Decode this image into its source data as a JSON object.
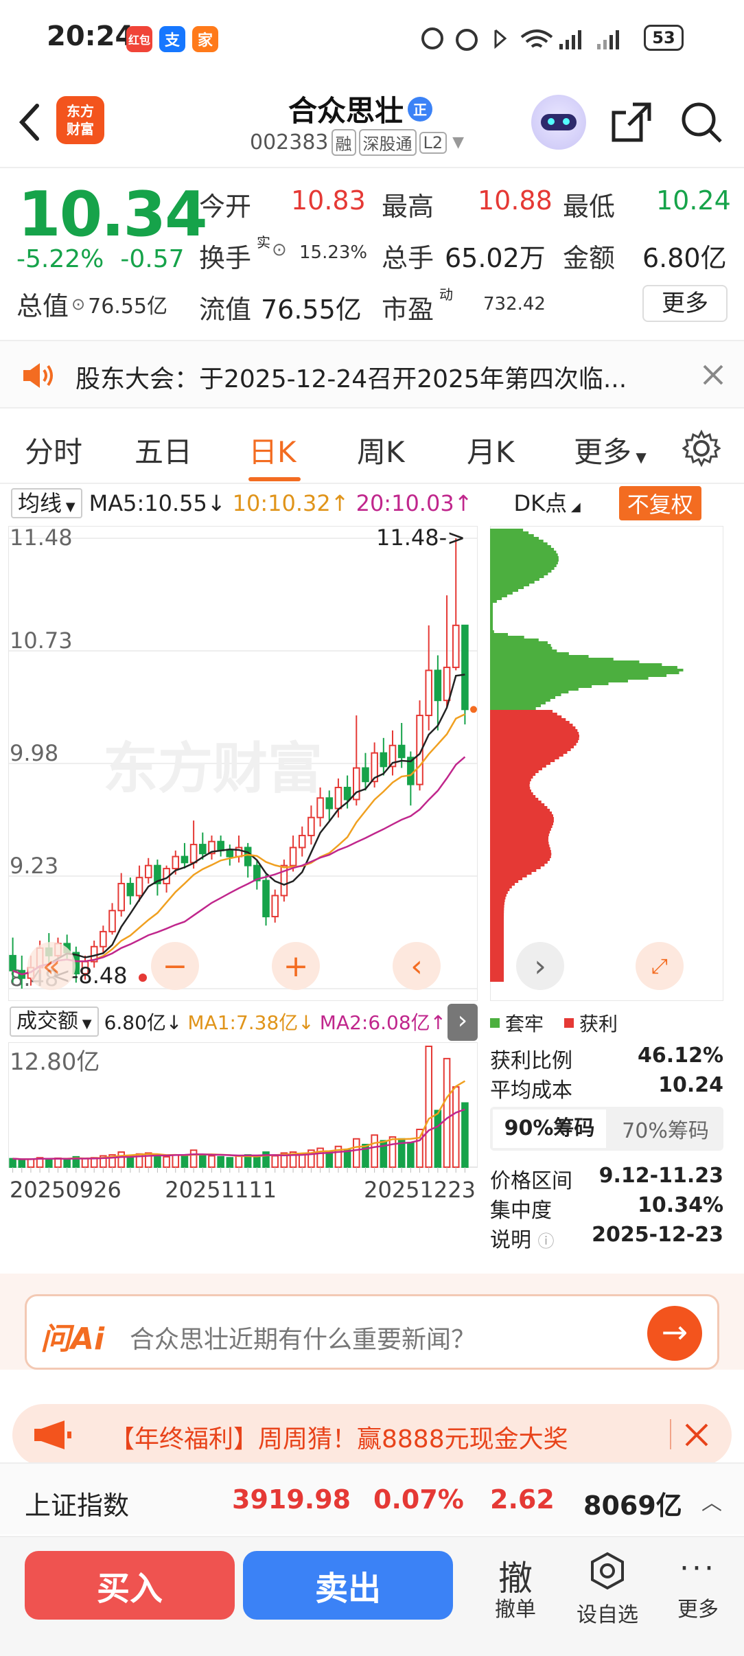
{
  "status": {
    "time": "20:24",
    "battery": "53",
    "app_icons": [
      "红包",
      "支",
      "家"
    ]
  },
  "header": {
    "logo": "东方\n财富",
    "name": "合众思壮",
    "code": "002383",
    "tags": [
      "融",
      "深股通",
      "L2"
    ],
    "zheng": "正"
  },
  "quote": {
    "price": "10.34",
    "pct": "-5.22%",
    "chg": "-0.57",
    "open_label": "今开",
    "open": "10.83",
    "high_label": "最高",
    "high": "10.88",
    "low_label": "最低",
    "low": "10.24",
    "turnover_label": "换手",
    "turnover_sup": "实",
    "turnover": "15.23%",
    "vol_label": "总手",
    "vol": "65.02万",
    "amount_label": "金额",
    "amount": "6.80亿",
    "mcap_label": "总值",
    "mcap": "76.55亿",
    "float_label": "流值",
    "float": "76.55亿",
    "pe_label": "市盈",
    "pe_sup": "动",
    "pe": "732.42",
    "more": "更多"
  },
  "notice": {
    "text": "股东大会：于2025-12-24召开2025年第四次临..."
  },
  "tabs": [
    "分时",
    "五日",
    "日K",
    "周K",
    "月K",
    "更多"
  ],
  "kbar": {
    "indicator": "均线",
    "ma5": "MA5:10.55↓",
    "ma10": "10:10.32↑",
    "ma20": "20:10.03↑",
    "dk": "DK点",
    "fq": "不复权"
  },
  "colors": {
    "up": "#e53935",
    "down": "#16a34a",
    "accent": "#f36c21",
    "ma5": "#222222",
    "ma10": "#f0a020",
    "ma20": "#c0268c"
  },
  "chart_data": {
    "type": "candlestick",
    "y_labels": [
      "11.48",
      "10.73",
      "9.98",
      "9.23",
      "8.48"
    ],
    "ylim": [
      8.48,
      11.48
    ],
    "max_label": "11.48->",
    "min_label": "<-8.48",
    "x_labels": [
      "20250926",
      "20251111",
      "20251223"
    ],
    "candles": [
      [
        8.7,
        8.6,
        8.82,
        8.52
      ],
      [
        8.6,
        8.55,
        8.7,
        8.48
      ],
      [
        8.55,
        8.62,
        8.7,
        8.5
      ],
      [
        8.62,
        8.75,
        8.8,
        8.58
      ],
      [
        8.75,
        8.7,
        8.85,
        8.64
      ],
      [
        8.7,
        8.78,
        8.82,
        8.66
      ],
      [
        8.78,
        8.72,
        8.84,
        8.68
      ],
      [
        8.72,
        8.58,
        8.76,
        8.52
      ],
      [
        8.58,
        8.66,
        8.7,
        8.54
      ],
      [
        8.66,
        8.76,
        8.8,
        8.62
      ],
      [
        8.76,
        8.86,
        8.9,
        8.72
      ],
      [
        8.86,
        9.0,
        9.05,
        8.84
      ],
      [
        9.0,
        9.18,
        9.25,
        8.96
      ],
      [
        9.18,
        9.1,
        9.22,
        9.04
      ],
      [
        9.1,
        9.22,
        9.3,
        9.06
      ],
      [
        9.22,
        9.3,
        9.35,
        9.18
      ],
      [
        9.3,
        9.18,
        9.34,
        9.1
      ],
      [
        9.18,
        9.28,
        9.3,
        9.12
      ],
      [
        9.28,
        9.36,
        9.4,
        9.24
      ],
      [
        9.36,
        9.32,
        9.45,
        9.28
      ],
      [
        9.32,
        9.44,
        9.6,
        9.28
      ],
      [
        9.44,
        9.38,
        9.52,
        9.34
      ],
      [
        9.38,
        9.46,
        9.5,
        9.34
      ],
      [
        9.46,
        9.4,
        9.5,
        9.36
      ],
      [
        9.4,
        9.36,
        9.44,
        9.3
      ],
      [
        9.36,
        9.42,
        9.5,
        9.32
      ],
      [
        9.42,
        9.3,
        9.45,
        9.22
      ],
      [
        9.3,
        9.2,
        9.34,
        9.14
      ],
      [
        9.2,
        8.96,
        9.24,
        8.9
      ],
      [
        8.96,
        9.1,
        9.14,
        8.92
      ],
      [
        9.1,
        9.3,
        9.34,
        9.06
      ],
      [
        9.3,
        9.42,
        9.5,
        9.26
      ],
      [
        9.42,
        9.5,
        9.56,
        9.36
      ],
      [
        9.5,
        9.62,
        9.7,
        9.44
      ],
      [
        9.62,
        9.75,
        9.82,
        9.56
      ],
      [
        9.75,
        9.68,
        9.8,
        9.6
      ],
      [
        9.68,
        9.82,
        9.88,
        9.62
      ],
      [
        9.82,
        9.74,
        9.9,
        9.68
      ],
      [
        9.74,
        9.95,
        10.3,
        9.7
      ],
      [
        9.95,
        9.86,
        10.05,
        9.8
      ],
      [
        9.86,
        10.05,
        10.12,
        9.82
      ],
      [
        10.05,
        9.96,
        10.15,
        9.9
      ],
      [
        9.96,
        10.1,
        10.2,
        9.9
      ],
      [
        10.1,
        10.02,
        10.25,
        9.95
      ],
      [
        10.02,
        9.84,
        10.06,
        9.7
      ],
      [
        9.84,
        10.3,
        10.4,
        9.8
      ],
      [
        10.3,
        10.6,
        10.9,
        10.2
      ],
      [
        10.6,
        10.4,
        10.7,
        10.2
      ],
      [
        10.4,
        10.62,
        11.1,
        10.35
      ],
      [
        10.62,
        10.9,
        11.48,
        10.6
      ],
      [
        10.9,
        10.34,
        10.88,
        10.24
      ]
    ],
    "volume": {
      "ylabel": "12.80亿",
      "label": "成交额",
      "value": "6.80亿↓",
      "ma1": "MA1:7.38亿↓",
      "ma2": "MA2:6.08亿↑",
      "values": [
        0.9,
        0.8,
        0.85,
        1.0,
        0.9,
        0.95,
        0.8,
        1.1,
        0.9,
        1.0,
        1.2,
        1.3,
        1.6,
        1.2,
        1.4,
        1.5,
        1.2,
        1.1,
        1.3,
        1.2,
        1.8,
        1.3,
        1.2,
        1.1,
        1.0,
        1.2,
        1.3,
        1.1,
        1.6,
        1.2,
        1.5,
        1.6,
        1.4,
        1.8,
        2.0,
        1.7,
        2.2,
        1.8,
        3.0,
        2.4,
        3.4,
        2.8,
        3.2,
        3.0,
        2.6,
        4.0,
        12.8,
        6.0,
        11.5,
        8.5,
        6.8
      ]
    }
  },
  "chips": {
    "legend_trap": "套牢",
    "legend_profit": "获利",
    "rows": [
      [
        "获利比例",
        "46.12%"
      ],
      [
        "平均成本",
        "10.24"
      ]
    ],
    "tab1": "90%筹码",
    "tab2": "70%筹码",
    "rows2": [
      [
        "价格区间",
        "9.12-11.23"
      ],
      [
        "集中度",
        "10.34%"
      ],
      [
        "说明",
        "2025-12-23"
      ]
    ]
  },
  "ai": {
    "logo": "问Ai",
    "placeholder": "合众思壮近期有什么重要新闻？"
  },
  "promo": {
    "text": "【年终福利】周周猜！赢8888元现金大奖"
  },
  "index": {
    "name": "上证指数",
    "value": "3919.98",
    "pct": "0.07%",
    "chg": "2.62",
    "amount": "8069亿"
  },
  "bottom": {
    "buy": "买入",
    "sell": "卖出",
    "cancel_icon": "撤",
    "cancel": "撤单",
    "watch": "设自选",
    "more": "更多"
  }
}
